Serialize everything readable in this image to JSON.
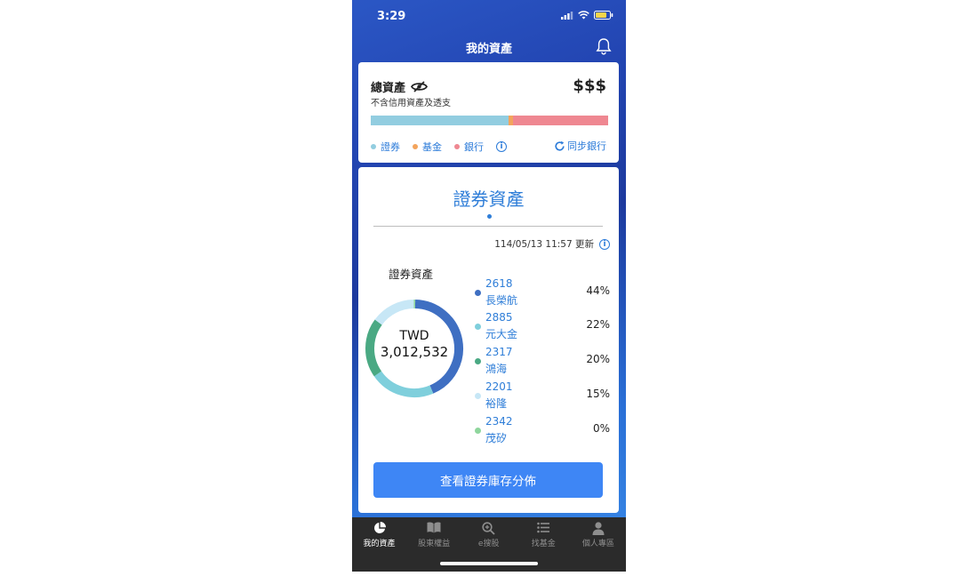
{
  "status_bar": {
    "time": "3:29"
  },
  "header": {
    "title": "我的資產"
  },
  "summary": {
    "title": "總資產",
    "subtitle": "不含信用資產及透支",
    "value": "$$$",
    "bar_shares": {
      "securities": 0.58,
      "funds": 0.02,
      "bank": 0.4
    },
    "legend": [
      {
        "label": "證券",
        "color": "#92cde0"
      },
      {
        "label": "基金",
        "color": "#f3a45c"
      },
      {
        "label": "銀行",
        "color": "#ef8791"
      }
    ],
    "sync_label": "同步銀行"
  },
  "securities": {
    "title": "證券資產",
    "updated": "114/05/13 11:57 更新",
    "section_label": "證券資產",
    "currency": "TWD",
    "total": "3,012,532",
    "holdings": [
      {
        "code": "2618",
        "name": "長榮航",
        "pct": "44%",
        "share": 0.44,
        "color": "#3f6fc2"
      },
      {
        "code": "2885",
        "name": "元大金",
        "pct": "22%",
        "share": 0.22,
        "color": "#7fcfdc"
      },
      {
        "code": "2317",
        "name": "鴻海",
        "pct": "20%",
        "share": 0.2,
        "color": "#4aa983"
      },
      {
        "code": "2201",
        "name": "裕隆",
        "pct": "15%",
        "share": 0.15,
        "color": "#c7e7f6"
      },
      {
        "code": "2342",
        "name": "茂矽",
        "pct": "0%",
        "share": 0.005,
        "color": "#8fd69d"
      }
    ],
    "button_label": "查看證券庫存分佈"
  },
  "tabbar": {
    "items": [
      {
        "label": "我的資產",
        "icon": "pie-chart-icon",
        "active": true
      },
      {
        "label": "股東權益",
        "icon": "book-icon",
        "active": false
      },
      {
        "label": "e搜股",
        "icon": "search-plus-icon",
        "active": false
      },
      {
        "label": "找基金",
        "icon": "list-icon",
        "active": false
      },
      {
        "label": "個人專區",
        "icon": "person-icon",
        "active": false
      }
    ]
  }
}
